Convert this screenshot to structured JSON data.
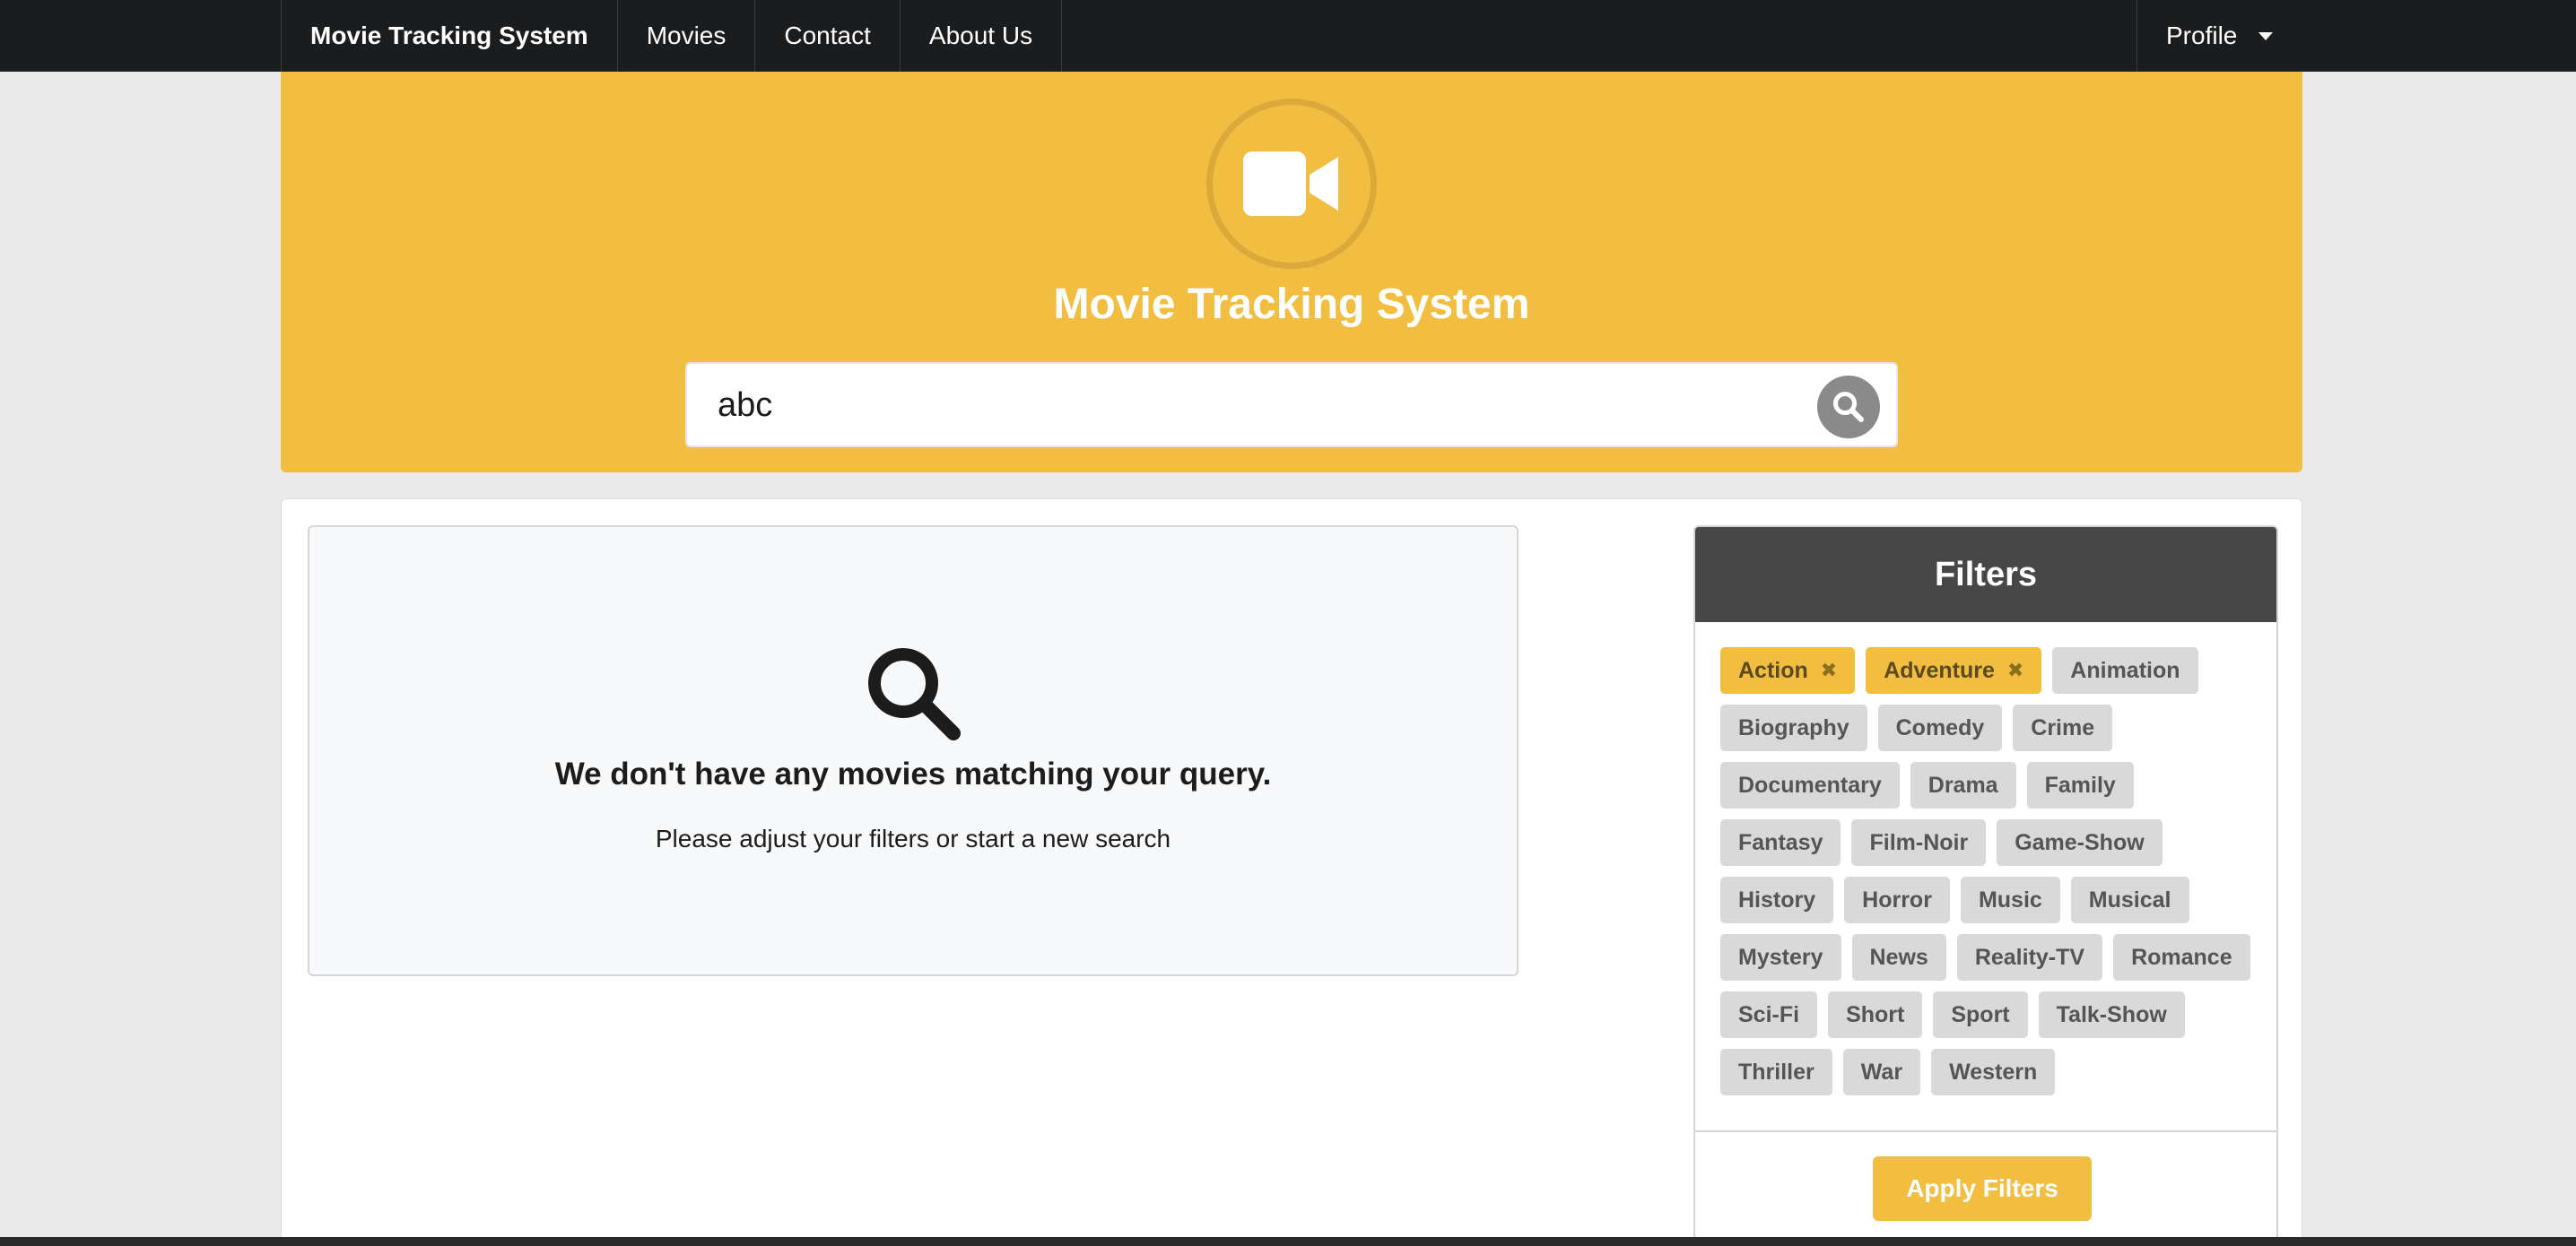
{
  "navbar": {
    "brand": "Movie Tracking System",
    "links": [
      "Movies",
      "Contact",
      "About Us"
    ],
    "profile_label": "Profile",
    "profile_icon": "caret-down-icon"
  },
  "hero": {
    "icon": "video-camera-icon",
    "title": "Movie Tracking System",
    "search_value": "abc",
    "search_icon": "search-icon"
  },
  "results": {
    "empty_icon": "search-icon",
    "empty_title": "We don't have any movies matching your query.",
    "empty_subtitle": "Please adjust your filters or start a new search"
  },
  "filters": {
    "title": "Filters",
    "genres": [
      {
        "label": "Action",
        "active": true
      },
      {
        "label": "Adventure",
        "active": true
      },
      {
        "label": "Animation",
        "active": false
      },
      {
        "label": "Biography",
        "active": false
      },
      {
        "label": "Comedy",
        "active": false
      },
      {
        "label": "Crime",
        "active": false
      },
      {
        "label": "Documentary",
        "active": false
      },
      {
        "label": "Drama",
        "active": false
      },
      {
        "label": "Family",
        "active": false
      },
      {
        "label": "Fantasy",
        "active": false
      },
      {
        "label": "Film-Noir",
        "active": false
      },
      {
        "label": "Game-Show",
        "active": false
      },
      {
        "label": "History",
        "active": false
      },
      {
        "label": "Horror",
        "active": false
      },
      {
        "label": "Music",
        "active": false
      },
      {
        "label": "Musical",
        "active": false
      },
      {
        "label": "Mystery",
        "active": false
      },
      {
        "label": "News",
        "active": false
      },
      {
        "label": "Reality-TV",
        "active": false
      },
      {
        "label": "Romance",
        "active": false
      },
      {
        "label": "Sci-Fi",
        "active": false
      },
      {
        "label": "Short",
        "active": false
      },
      {
        "label": "Sport",
        "active": false
      },
      {
        "label": "Talk-Show",
        "active": false
      },
      {
        "label": "Thriller",
        "active": false
      },
      {
        "label": "War",
        "active": false
      },
      {
        "label": "Western",
        "active": false
      }
    ],
    "apply_label": "Apply Filters"
  },
  "colors": {
    "accent": "#f2be42",
    "navbar": "#1b1c1d",
    "filters_header": "#474747",
    "tag": "#d9d9d9"
  }
}
